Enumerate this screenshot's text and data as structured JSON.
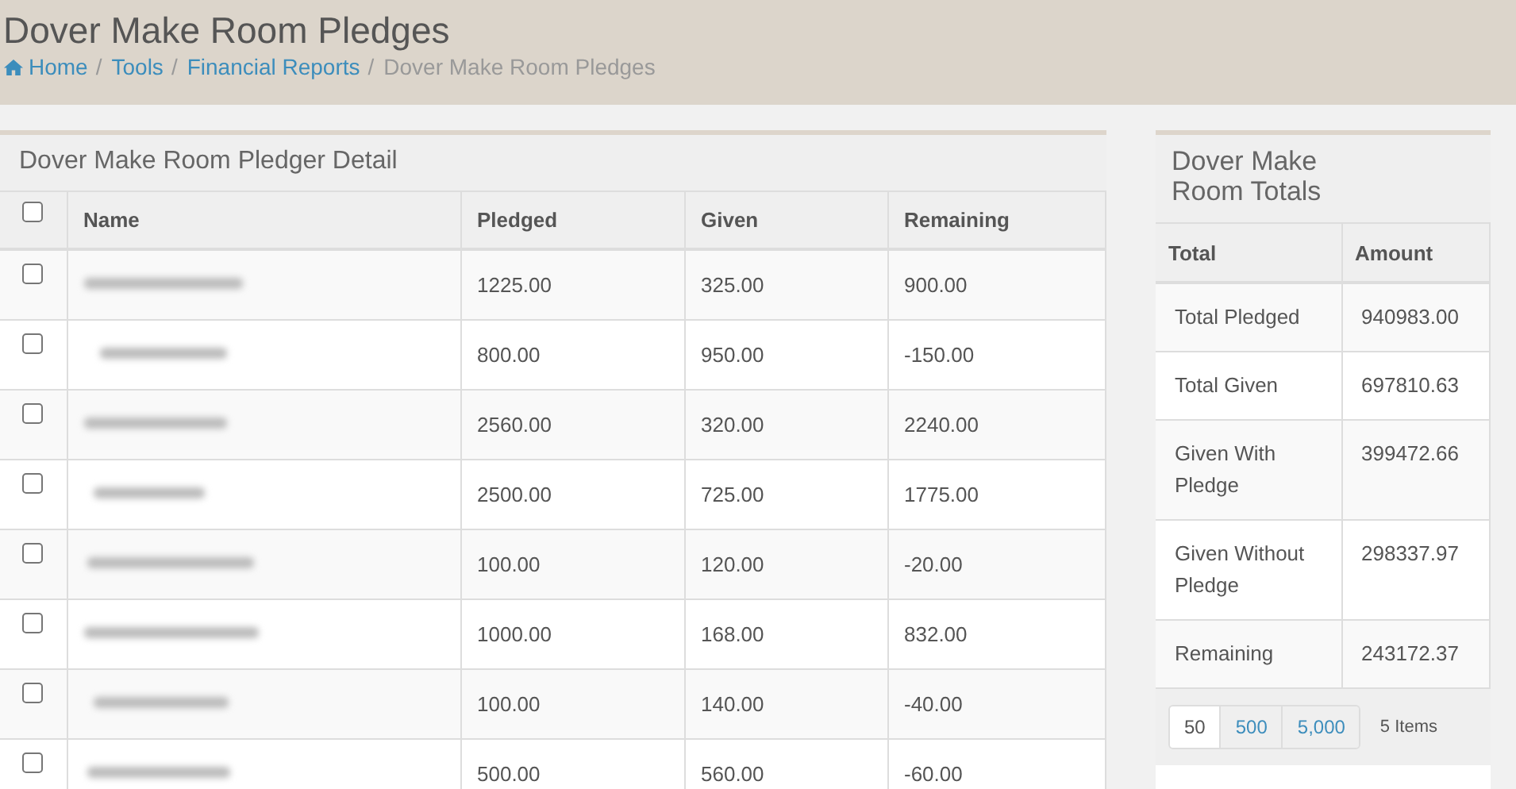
{
  "page": {
    "title": "Dover Make Room Pledges",
    "breadcrumb": [
      {
        "label": "Home",
        "kind": "home",
        "separator": "/"
      },
      {
        "label": "Tools",
        "kind": "link",
        "separator": "/"
      },
      {
        "label": "Financial Reports",
        "kind": "link",
        "separator": "/"
      },
      {
        "label": "Dover Make Room Pledges",
        "kind": "current"
      }
    ]
  },
  "detail": {
    "title": "Dover Make Room Pledger Detail",
    "select_all": {
      "checked": false
    },
    "columns": [
      "Name",
      "Pledged",
      "Given",
      "Remaining"
    ],
    "rows": [
      {
        "checked": false,
        "pledged": "1225.00",
        "given": "325.00",
        "remaining": "900.00"
      },
      {
        "checked": false,
        "pledged": "800.00",
        "given": "950.00",
        "remaining": "-150.00"
      },
      {
        "checked": false,
        "pledged": "2560.00",
        "given": "320.00",
        "remaining": "2240.00"
      },
      {
        "checked": false,
        "pledged": "2500.00",
        "given": "725.00",
        "remaining": "1775.00"
      },
      {
        "checked": false,
        "pledged": "100.00",
        "given": "120.00",
        "remaining": "-20.00"
      },
      {
        "checked": false,
        "pledged": "1000.00",
        "given": "168.00",
        "remaining": "832.00"
      },
      {
        "checked": false,
        "pledged": "100.00",
        "given": "140.00",
        "remaining": "-40.00"
      },
      {
        "checked": false,
        "pledged": "500.00",
        "given": "560.00",
        "remaining": "-60.00"
      }
    ]
  },
  "totals": {
    "title": "Dover Make Room Totals",
    "columns": [
      "Total",
      "Amount"
    ],
    "rows": [
      {
        "label": "Total Pledged",
        "amount": "940983.00"
      },
      {
        "label": "Total Given",
        "amount": "697810.63"
      },
      {
        "label": "Given With Pledge",
        "amount": "399472.66"
      },
      {
        "label": "Given Without Pledge",
        "amount": "298337.97"
      },
      {
        "label": "Remaining",
        "amount": "243172.37"
      }
    ],
    "page_sizes": [
      {
        "label": "50",
        "selected": true
      },
      {
        "label": "500",
        "selected": false
      },
      {
        "label": "5,000",
        "selected": false
      }
    ],
    "item_count": "5 Items"
  }
}
